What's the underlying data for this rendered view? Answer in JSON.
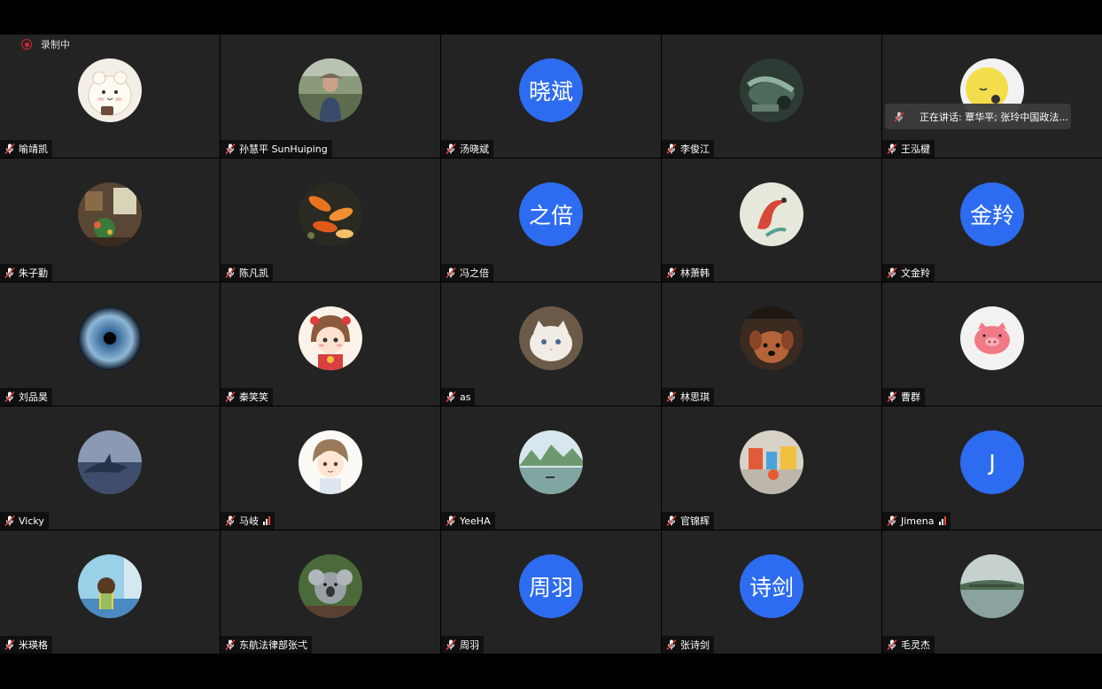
{
  "recording": {
    "label": "录制中"
  },
  "speaking": {
    "text": "正在讲话: 覃华平; 张玲中国政法..."
  },
  "colors": {
    "tile_bg": "#232323",
    "avatar_blue": "#2d6cf0",
    "recording_red": "#dd2233",
    "muted_mic": "#e04040"
  },
  "participants": [
    {
      "name": "喻靖凯",
      "avatar": {
        "type": "image",
        "icon": "cartoon-cat-avatar-icon"
      }
    },
    {
      "name": "孙慧平 SunHuiping",
      "avatar": {
        "type": "image",
        "icon": "person-photo-avatar-icon"
      }
    },
    {
      "name": "汤晓斌",
      "avatar": {
        "type": "text",
        "text": "晓斌"
      }
    },
    {
      "name": "李俊江",
      "avatar": {
        "type": "image",
        "icon": "nature-photo-avatar-icon"
      }
    },
    {
      "name": "王泓楗",
      "avatar": {
        "type": "image",
        "icon": "yellow-moon-avatar-icon"
      }
    },
    {
      "name": "朱子勤",
      "avatar": {
        "type": "image",
        "icon": "room-photo-avatar-icon"
      }
    },
    {
      "name": "陈凡凯",
      "avatar": {
        "type": "image",
        "icon": "koi-fish-photo-avatar-icon"
      }
    },
    {
      "name": "冯之倍",
      "avatar": {
        "type": "text",
        "text": "之倍"
      }
    },
    {
      "name": "林萧韩",
      "avatar": {
        "type": "image",
        "icon": "koi-painting-avatar-icon"
      }
    },
    {
      "name": "文金羚",
      "avatar": {
        "type": "text",
        "text": "金羚"
      }
    },
    {
      "name": "刘品昊",
      "avatar": {
        "type": "image",
        "icon": "eye-iris-avatar-icon"
      }
    },
    {
      "name": "秦笑笑",
      "avatar": {
        "type": "image",
        "icon": "cartoon-girl-avatar-icon"
      }
    },
    {
      "name": "as",
      "avatar": {
        "type": "image",
        "icon": "white-cat-photo-avatar-icon"
      }
    },
    {
      "name": "林思琪",
      "avatar": {
        "type": "image",
        "icon": "brown-dog-avatar-icon"
      }
    },
    {
      "name": "曹群",
      "avatar": {
        "type": "image",
        "icon": "pink-pig-avatar-icon"
      }
    },
    {
      "name": "Vicky",
      "avatar": {
        "type": "image",
        "icon": "dolphin-photo-avatar-icon"
      }
    },
    {
      "name": "马岐",
      "avatar": {
        "type": "image",
        "icon": "anime-boy-avatar-icon"
      },
      "signal": true
    },
    {
      "name": "YeeHA",
      "avatar": {
        "type": "image",
        "icon": "river-landscape-avatar-icon"
      }
    },
    {
      "name": "官锦辉",
      "avatar": {
        "type": "image",
        "icon": "street-scene-avatar-icon"
      }
    },
    {
      "name": "Jimena",
      "avatar": {
        "type": "text",
        "text": "J"
      },
      "signal": true
    },
    {
      "name": "米瑛格",
      "avatar": {
        "type": "image",
        "icon": "cartoon-window-avatar-icon"
      }
    },
    {
      "name": "东航法律部张弌",
      "avatar": {
        "type": "image",
        "icon": "koala-photo-avatar-icon"
      }
    },
    {
      "name": "周羽",
      "avatar": {
        "type": "text",
        "text": "周羽"
      }
    },
    {
      "name": "张诗剑",
      "avatar": {
        "type": "text",
        "text": "诗剑"
      }
    },
    {
      "name": "毛灵杰",
      "avatar": {
        "type": "image",
        "icon": "lake-tree-avatar-icon"
      }
    }
  ]
}
